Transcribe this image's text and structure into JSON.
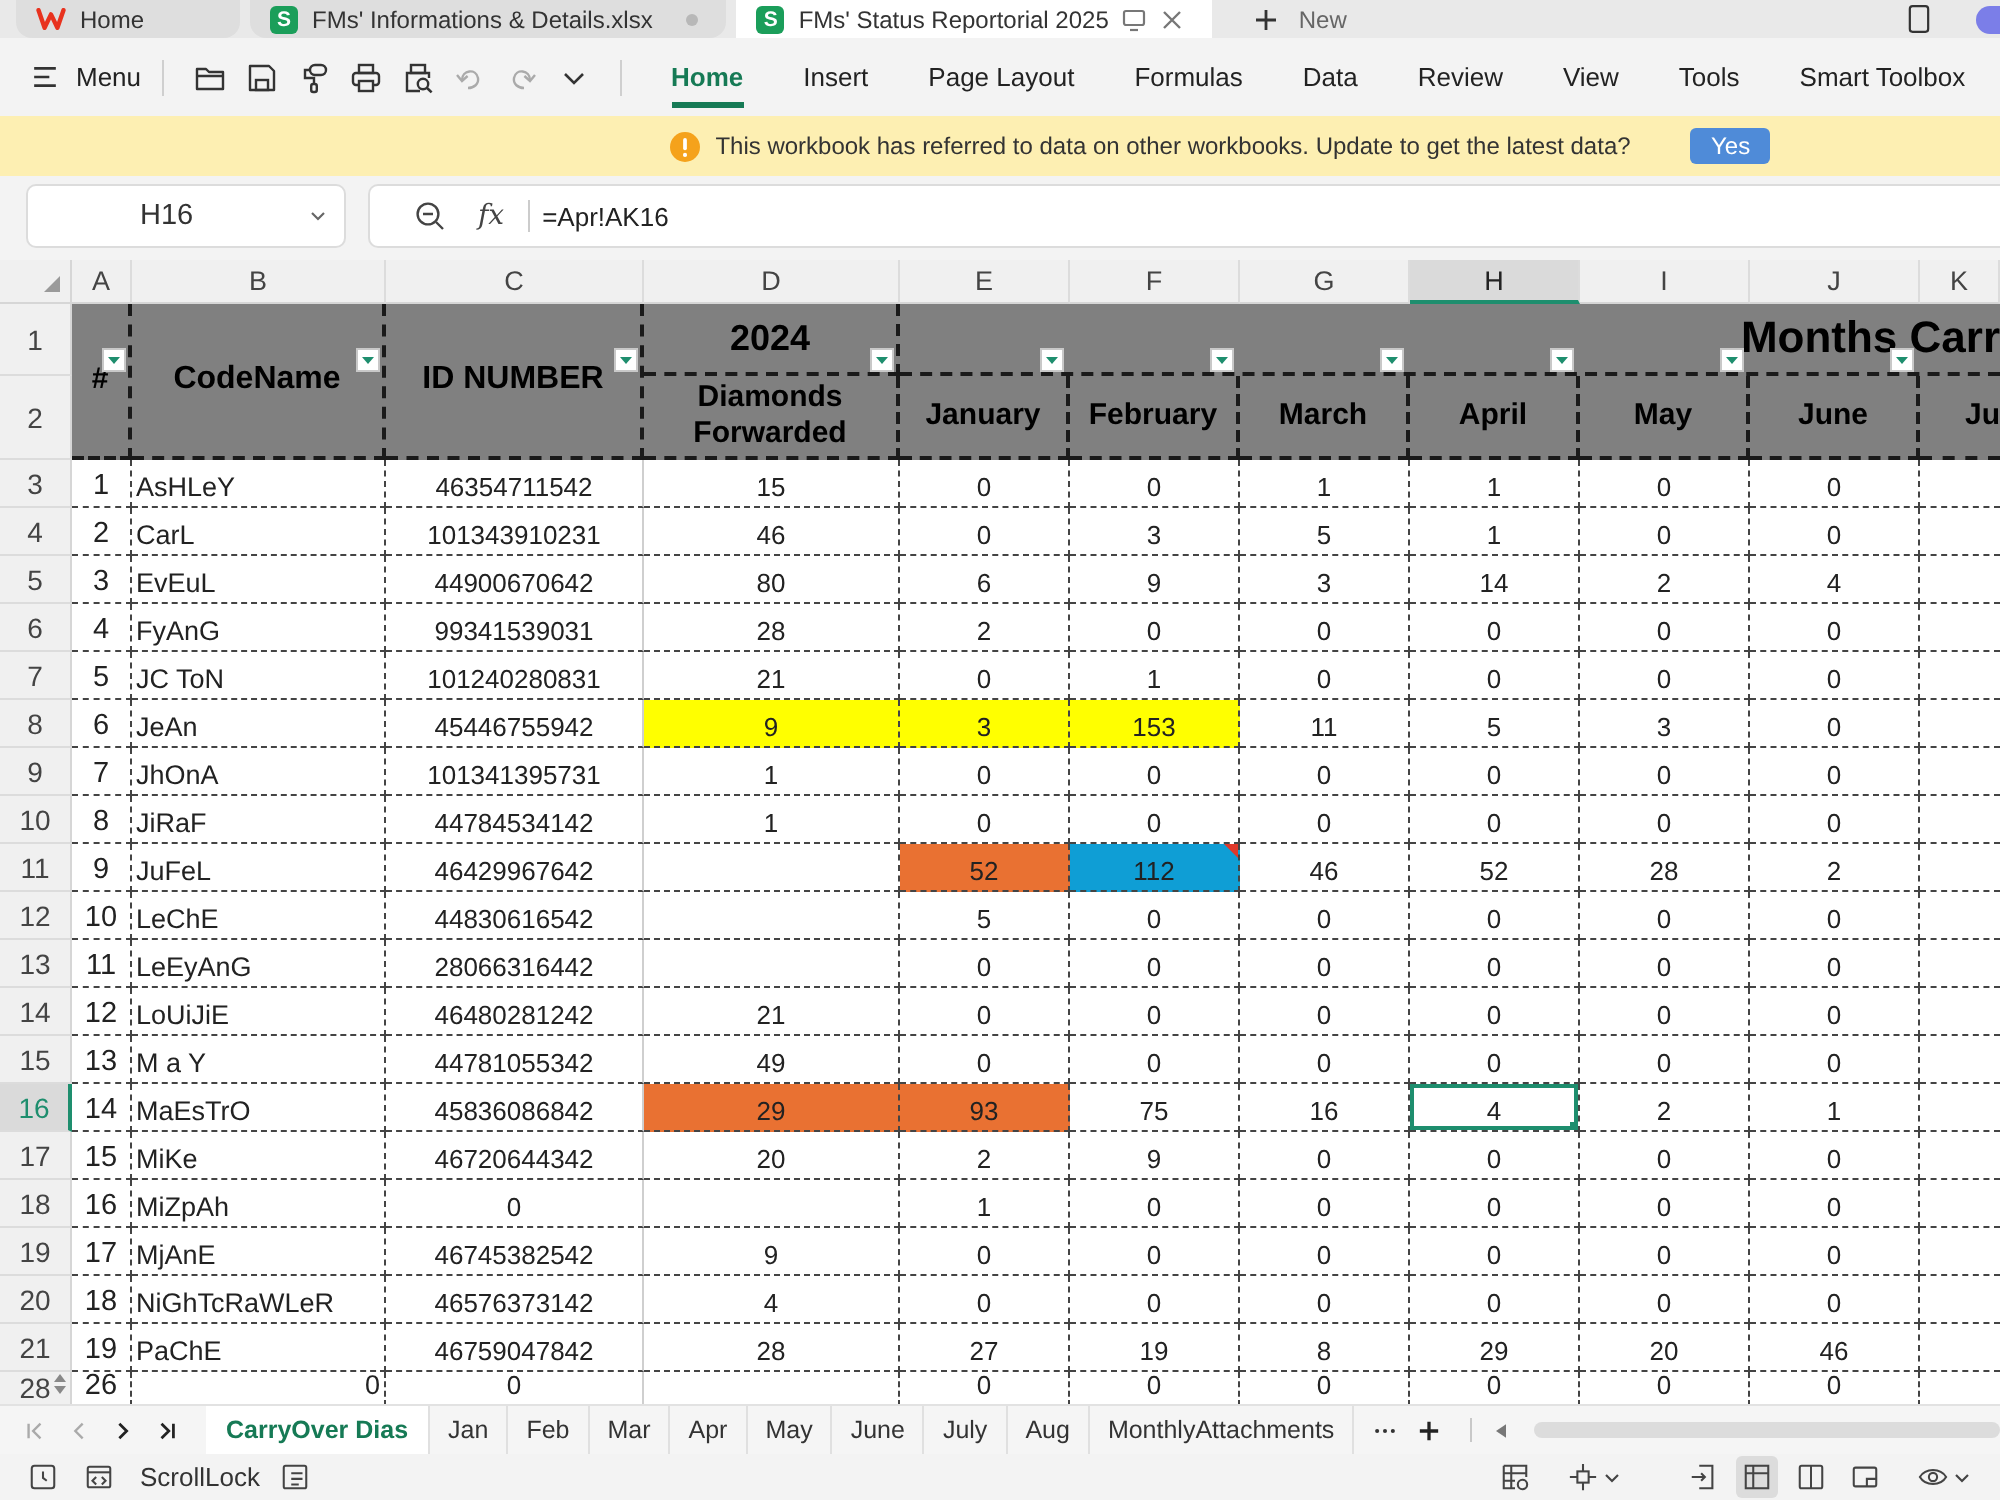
{
  "app_tabs": [
    {
      "kind": "home",
      "label": "Home",
      "selected": false
    },
    {
      "kind": "file",
      "badge": "S",
      "label": "FMs' Informations & Details.xlsx",
      "selected": false
    },
    {
      "kind": "file",
      "badge": "S",
      "label": "FMs' Status Reportorial 2025",
      "selected": true
    }
  ],
  "new_tab": {
    "label": "New"
  },
  "toolbar": {
    "menu_label": "Menu"
  },
  "ribbon_tabs": [
    {
      "label": "Home",
      "selected": true
    },
    {
      "label": "Insert",
      "selected": false
    },
    {
      "label": "Page Layout",
      "selected": false
    },
    {
      "label": "Formulas",
      "selected": false
    },
    {
      "label": "Data",
      "selected": false
    },
    {
      "label": "Review",
      "selected": false
    },
    {
      "label": "View",
      "selected": false
    },
    {
      "label": "Tools",
      "selected": false
    },
    {
      "label": "Smart Toolbox",
      "selected": false
    }
  ],
  "notice": {
    "message": "This workbook has referred to data on other workbooks. Update to get the latest data?",
    "button": "Yes"
  },
  "formula_bar": {
    "cell": "H16",
    "function_label": "fx",
    "formula": "=Apr!AK16"
  },
  "sheet": {
    "columns": [
      {
        "letter": "A",
        "selected": false
      },
      {
        "letter": "B",
        "selected": false
      },
      {
        "letter": "C",
        "selected": false
      },
      {
        "letter": "D",
        "selected": false
      },
      {
        "letter": "E",
        "selected": false
      },
      {
        "letter": "F",
        "selected": false
      },
      {
        "letter": "G",
        "selected": false
      },
      {
        "letter": "H",
        "selected": true
      },
      {
        "letter": "I",
        "selected": false
      },
      {
        "letter": "J",
        "selected": false
      },
      {
        "letter": "K",
        "selected": false
      }
    ],
    "header_rows": [
      "1",
      "2"
    ],
    "header": {
      "number": {
        "text": "#",
        "filter": true
      },
      "code_name": {
        "text": "CodeName",
        "filter": true
      },
      "id_number": {
        "text": "ID NUMBER",
        "filter": true
      },
      "year": {
        "text": "2024",
        "filter": true
      },
      "forwarded": "Diamonds Forwarded",
      "group": {
        "text": "Months Carr",
        "filters": [
          true,
          true,
          true,
          true,
          true,
          true,
          false
        ]
      },
      "months": [
        "January",
        "February",
        "March",
        "April",
        "May",
        "June",
        "Ju"
      ]
    },
    "rows": [
      {
        "row": "3",
        "selected": false,
        "hidden_above": false,
        "kind": "member",
        "cells": [
          {
            "value": "1",
            "comment": false
          },
          {
            "value": "AsHLeY",
            "comment": false
          },
          {
            "value": "46354711542",
            "comment": false
          },
          {
            "value": "15",
            "comment": false
          },
          {
            "value": "0",
            "comment": false
          },
          {
            "value": "0",
            "comment": false
          },
          {
            "value": "1",
            "comment": false
          },
          {
            "value": "1",
            "comment": false
          },
          {
            "value": "0",
            "comment": false
          },
          {
            "value": "0",
            "comment": false
          }
        ]
      },
      {
        "row": "4",
        "selected": false,
        "hidden_above": false,
        "kind": "member",
        "cells": [
          {
            "value": "2",
            "comment": false
          },
          {
            "value": "CarL",
            "comment": false
          },
          {
            "value": "101343910231",
            "comment": false
          },
          {
            "value": "46",
            "comment": false
          },
          {
            "value": "0",
            "comment": false
          },
          {
            "value": "3",
            "comment": false
          },
          {
            "value": "5",
            "comment": false
          },
          {
            "value": "1",
            "comment": false
          },
          {
            "value": "0",
            "comment": false
          },
          {
            "value": "0",
            "comment": false
          }
        ]
      },
      {
        "row": "5",
        "selected": false,
        "hidden_above": false,
        "kind": "member",
        "cells": [
          {
            "value": "3",
            "comment": false
          },
          {
            "value": "EvEuL",
            "comment": false
          },
          {
            "value": "44900670642",
            "comment": false
          },
          {
            "value": "80",
            "comment": false
          },
          {
            "value": "6",
            "comment": false
          },
          {
            "value": "9",
            "comment": false
          },
          {
            "value": "3",
            "comment": false
          },
          {
            "value": "14",
            "comment": false
          },
          {
            "value": "2",
            "comment": false
          },
          {
            "value": "4",
            "comment": false
          }
        ]
      },
      {
        "row": "6",
        "selected": false,
        "hidden_above": false,
        "kind": "member",
        "cells": [
          {
            "value": "4",
            "comment": false
          },
          {
            "value": "FyAnG",
            "comment": false
          },
          {
            "value": "99341539031",
            "comment": false
          },
          {
            "value": "28",
            "comment": false
          },
          {
            "value": "2",
            "comment": false
          },
          {
            "value": "0",
            "comment": false
          },
          {
            "value": "0",
            "comment": false
          },
          {
            "value": "0",
            "comment": false
          },
          {
            "value": "0",
            "comment": false
          },
          {
            "value": "0",
            "comment": false
          }
        ]
      },
      {
        "row": "7",
        "selected": false,
        "hidden_above": false,
        "kind": "member",
        "cells": [
          {
            "value": "5",
            "comment": false
          },
          {
            "value": "JC ToN",
            "comment": false
          },
          {
            "value": "101240280831",
            "comment": false
          },
          {
            "value": "21",
            "comment": false
          },
          {
            "value": "0",
            "comment": false
          },
          {
            "value": "1",
            "comment": false
          },
          {
            "value": "0",
            "comment": false
          },
          {
            "value": "0",
            "comment": false
          },
          {
            "value": "0",
            "comment": false
          },
          {
            "value": "0",
            "comment": false
          }
        ]
      },
      {
        "row": "8",
        "selected": false,
        "hidden_above": false,
        "kind": "member",
        "cells": [
          {
            "value": "6",
            "comment": false
          },
          {
            "value": "JeAn",
            "comment": false
          },
          {
            "value": "45446755942",
            "comment": false
          },
          {
            "value": "9",
            "color": "#ffff00",
            "comment": false
          },
          {
            "value": "3",
            "color": "#ffff00",
            "comment": false
          },
          {
            "value": "153",
            "color": "#ffff00",
            "comment": false
          },
          {
            "value": "11",
            "comment": false
          },
          {
            "value": "5",
            "comment": false
          },
          {
            "value": "3",
            "comment": false
          },
          {
            "value": "0",
            "comment": false
          }
        ]
      },
      {
        "row": "9",
        "selected": false,
        "hidden_above": false,
        "kind": "member",
        "cells": [
          {
            "value": "7",
            "comment": false
          },
          {
            "value": "JhOnA",
            "comment": false
          },
          {
            "value": "101341395731",
            "comment": false
          },
          {
            "value": "1",
            "comment": false
          },
          {
            "value": "0",
            "comment": false
          },
          {
            "value": "0",
            "comment": false
          },
          {
            "value": "0",
            "comment": false
          },
          {
            "value": "0",
            "comment": false
          },
          {
            "value": "0",
            "comment": false
          },
          {
            "value": "0",
            "comment": false
          }
        ]
      },
      {
        "row": "10",
        "selected": false,
        "hidden_above": false,
        "kind": "member",
        "cells": [
          {
            "value": "8",
            "comment": false
          },
          {
            "value": "JiRaF",
            "comment": false
          },
          {
            "value": "44784534142",
            "comment": false
          },
          {
            "value": "1",
            "comment": false
          },
          {
            "value": "0",
            "comment": false
          },
          {
            "value": "0",
            "comment": false
          },
          {
            "value": "0",
            "comment": false
          },
          {
            "value": "0",
            "comment": false
          },
          {
            "value": "0",
            "comment": false
          },
          {
            "value": "0",
            "comment": false
          }
        ]
      },
      {
        "row": "11",
        "selected": false,
        "hidden_above": false,
        "kind": "member",
        "cells": [
          {
            "value": "9",
            "comment": false
          },
          {
            "value": "JuFeL",
            "comment": false
          },
          {
            "value": "46429967642",
            "comment": false
          },
          {
            "comment": false
          },
          {
            "value": "52",
            "color": "#e97132",
            "comment": false
          },
          {
            "value": "112",
            "color": "#0f9ed5",
            "comment": true
          },
          {
            "value": "46",
            "comment": false
          },
          {
            "value": "52",
            "comment": false
          },
          {
            "value": "28",
            "comment": false
          },
          {
            "value": "2",
            "comment": false
          }
        ]
      },
      {
        "row": "12",
        "selected": false,
        "hidden_above": false,
        "kind": "member",
        "cells": [
          {
            "value": "10",
            "comment": false
          },
          {
            "value": "LeChE",
            "comment": false
          },
          {
            "value": "44830616542",
            "comment": false
          },
          {
            "comment": false
          },
          {
            "value": "5",
            "comment": false
          },
          {
            "value": "0",
            "comment": false
          },
          {
            "value": "0",
            "comment": false
          },
          {
            "value": "0",
            "comment": false
          },
          {
            "value": "0",
            "comment": false
          },
          {
            "value": "0",
            "comment": false
          }
        ]
      },
      {
        "row": "13",
        "selected": false,
        "hidden_above": false,
        "kind": "member",
        "cells": [
          {
            "value": "11",
            "comment": false
          },
          {
            "value": "LeEyAnG",
            "comment": false
          },
          {
            "value": "28066316442",
            "comment": false
          },
          {
            "comment": false
          },
          {
            "value": "0",
            "comment": false
          },
          {
            "value": "0",
            "comment": false
          },
          {
            "value": "0",
            "comment": false
          },
          {
            "value": "0",
            "comment": false
          },
          {
            "value": "0",
            "comment": false
          },
          {
            "value": "0",
            "comment": false
          }
        ]
      },
      {
        "row": "14",
        "selected": false,
        "hidden_above": false,
        "kind": "member",
        "cells": [
          {
            "value": "12",
            "comment": false
          },
          {
            "value": "LoUiJiE",
            "comment": false
          },
          {
            "value": "46480281242",
            "comment": false
          },
          {
            "value": "21",
            "comment": false
          },
          {
            "value": "0",
            "comment": false
          },
          {
            "value": "0",
            "comment": false
          },
          {
            "value": "0",
            "comment": false
          },
          {
            "value": "0",
            "comment": false
          },
          {
            "value": "0",
            "comment": false
          },
          {
            "value": "0",
            "comment": false
          }
        ]
      },
      {
        "row": "15",
        "selected": false,
        "hidden_above": false,
        "kind": "member",
        "cells": [
          {
            "value": "13",
            "comment": false
          },
          {
            "value": "M a Y",
            "comment": false
          },
          {
            "value": "44781055342",
            "comment": false
          },
          {
            "value": "49",
            "comment": false
          },
          {
            "value": "0",
            "comment": false
          },
          {
            "value": "0",
            "comment": false
          },
          {
            "value": "0",
            "comment": false
          },
          {
            "value": "0",
            "comment": false
          },
          {
            "value": "0",
            "comment": false
          },
          {
            "value": "0",
            "comment": false
          }
        ]
      },
      {
        "row": "16",
        "selected": true,
        "hidden_above": false,
        "kind": "member",
        "cells": [
          {
            "value": "14",
            "comment": false
          },
          {
            "value": "MaEsTrO",
            "comment": false
          },
          {
            "value": "45836086842",
            "comment": false
          },
          {
            "value": "29",
            "color": "#e97132",
            "comment": false
          },
          {
            "value": "93",
            "color": "#e97132",
            "comment": false
          },
          {
            "value": "75",
            "comment": false
          },
          {
            "value": "16",
            "comment": false
          },
          {
            "value": "4",
            "comment": false
          },
          {
            "value": "2",
            "comment": false
          },
          {
            "value": "1",
            "comment": false
          }
        ]
      },
      {
        "row": "17",
        "selected": false,
        "hidden_above": false,
        "kind": "member",
        "cells": [
          {
            "value": "15",
            "comment": false
          },
          {
            "value": "MiKe",
            "comment": false
          },
          {
            "value": "46720644342",
            "comment": false
          },
          {
            "value": "20",
            "comment": false
          },
          {
            "value": "2",
            "comment": false
          },
          {
            "value": "9",
            "comment": false
          },
          {
            "value": "0",
            "comment": false
          },
          {
            "value": "0",
            "comment": false
          },
          {
            "value": "0",
            "comment": false
          },
          {
            "value": "0",
            "comment": false
          }
        ]
      },
      {
        "row": "18",
        "selected": false,
        "hidden_above": false,
        "kind": "member",
        "cells": [
          {
            "value": "16",
            "comment": false
          },
          {
            "value": "MiZpAh",
            "comment": false
          },
          {
            "value": "0",
            "comment": false
          },
          {
            "comment": false
          },
          {
            "value": "1",
            "comment": false
          },
          {
            "value": "0",
            "comment": false
          },
          {
            "value": "0",
            "comment": false
          },
          {
            "value": "0",
            "comment": false
          },
          {
            "value": "0",
            "comment": false
          },
          {
            "value": "0",
            "comment": false
          }
        ]
      },
      {
        "row": "19",
        "selected": false,
        "hidden_above": false,
        "kind": "member",
        "cells": [
          {
            "value": "17",
            "comment": false
          },
          {
            "value": "MjAnE",
            "comment": false
          },
          {
            "value": "46745382542",
            "comment": false
          },
          {
            "value": "9",
            "comment": false
          },
          {
            "value": "0",
            "comment": false
          },
          {
            "value": "0",
            "comment": false
          },
          {
            "value": "0",
            "comment": false
          },
          {
            "value": "0",
            "comment": false
          },
          {
            "value": "0",
            "comment": false
          },
          {
            "value": "0",
            "comment": false
          }
        ]
      },
      {
        "row": "20",
        "selected": false,
        "hidden_above": false,
        "kind": "member",
        "cells": [
          {
            "value": "18",
            "comment": false
          },
          {
            "value": "NiGhTcRaWLeR",
            "comment": false
          },
          {
            "value": "46576373142",
            "comment": false
          },
          {
            "value": "4",
            "comment": false
          },
          {
            "value": "0",
            "comment": false
          },
          {
            "value": "0",
            "comment": false
          },
          {
            "value": "0",
            "comment": false
          },
          {
            "value": "0",
            "comment": false
          },
          {
            "value": "0",
            "comment": false
          },
          {
            "value": "0",
            "comment": false
          }
        ]
      },
      {
        "row": "21",
        "selected": false,
        "hidden_above": false,
        "kind": "member",
        "cells": [
          {
            "value": "19",
            "comment": false
          },
          {
            "value": "PaChE",
            "comment": false
          },
          {
            "value": "46759047842",
            "comment": false
          },
          {
            "value": "28",
            "comment": false
          },
          {
            "value": "27",
            "comment": false
          },
          {
            "value": "19",
            "comment": false
          },
          {
            "value": "8",
            "comment": false
          },
          {
            "value": "29",
            "comment": false
          },
          {
            "value": "20",
            "comment": false
          },
          {
            "value": "46",
            "comment": false
          }
        ]
      },
      {
        "row": "28",
        "selected": false,
        "hidden_above": true,
        "kind": "formula",
        "cells": [
          {
            "value": "26",
            "comment": false
          },
          {
            "value": "0",
            "comment": false
          },
          {
            "value": "0",
            "comment": false
          },
          {
            "comment": false
          },
          {
            "value": "0",
            "comment": false
          },
          {
            "value": "0",
            "comment": false
          },
          {
            "value": "0",
            "comment": false
          },
          {
            "value": "0",
            "comment": false
          },
          {
            "value": "0",
            "comment": false
          },
          {
            "value": "0",
            "comment": false
          }
        ]
      }
    ]
  },
  "sheet_tabs": [
    {
      "label": "CarryOver Dias",
      "selected": true
    },
    {
      "label": "Jan",
      "selected": false
    },
    {
      "label": "Feb",
      "selected": false
    },
    {
      "label": "Mar",
      "selected": false
    },
    {
      "label": "Apr",
      "selected": false
    },
    {
      "label": "May",
      "selected": false
    },
    {
      "label": "June",
      "selected": false
    },
    {
      "label": "July",
      "selected": false
    },
    {
      "label": "Aug",
      "selected": false
    },
    {
      "label": "MonthlyAttachments",
      "selected": false
    }
  ],
  "status_bar": {
    "scroll_lock": "ScrollLock",
    "views": [
      {
        "kind": "page",
        "selected": false
      },
      {
        "kind": "normal",
        "selected": true
      },
      {
        "kind": "split",
        "selected": false
      },
      {
        "kind": "reading",
        "selected": false
      }
    ]
  }
}
